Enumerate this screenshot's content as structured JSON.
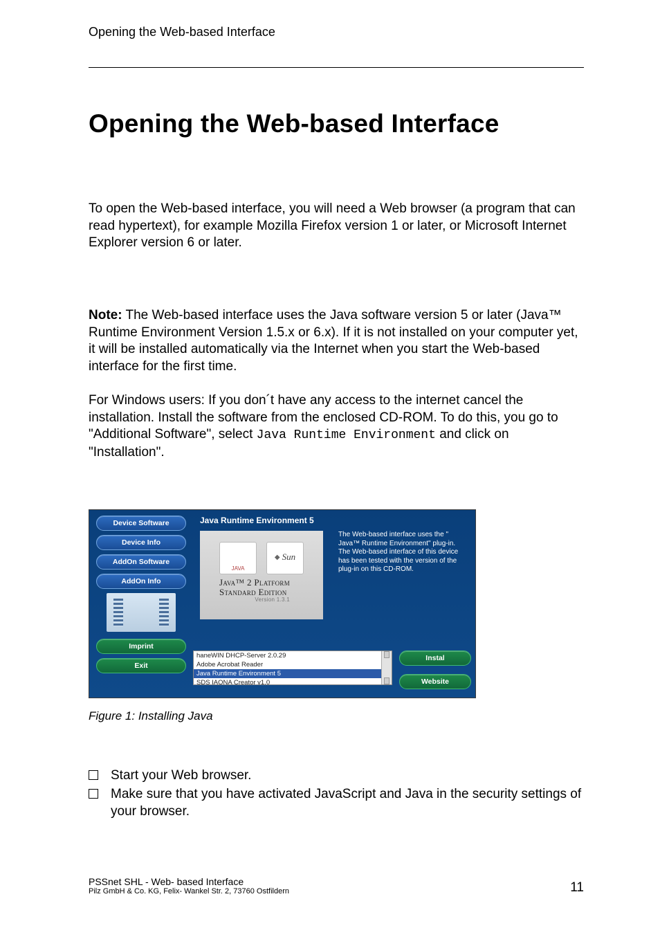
{
  "header": {
    "running": "Opening the Web-based Interface"
  },
  "chapter": {
    "title": "Opening the Web-based Interface"
  },
  "paragraphs": {
    "intro": "To open the Web-based interface, you will need a Web browser (a program that can read hypertext), for example Mozilla Firefox version 1 or later, or Microsoft Internet Explorer version 6 or later.",
    "note_label": "Note:",
    "note_body": " The Web-based interface uses the Java software version 5 or later (Java™ Runtime Environment Version 1.5.x or 6.x). If it is not installed on your computer yet, it will be installed automatically via the Internet when you start the Web-based interface for the first time.",
    "windows_pre": "For Windows users: If you don´t have any access to the internet cancel the installation. Install the software from the enclosed CD-ROM. To do this, you go to \"Additional Software\", select ",
    "windows_code": "Java Runtime Environment",
    "windows_post": " and click on \"Installation\"."
  },
  "figure": {
    "nav": {
      "device_software": "Device Software",
      "device_info": "Device Info",
      "addon_software": "AddOn Software",
      "addon_info": "AddOn Info",
      "imprint": "Imprint",
      "exit": "Exit"
    },
    "panel_title": "Java Runtime Environment 5",
    "badges": {
      "java": "JAVA",
      "sun": "Sun"
    },
    "platform": {
      "line1": "Java™ 2 Platform",
      "line2": "Standard Edition",
      "version": "Version 1.3.1"
    },
    "description": "The Web-based interface uses the \" Java™ Runtime Environment\" plug-in. The Web-based interface of this device has been tested with the version of the plug-in on this CD-ROM.",
    "list": {
      "opt1": "haneWIN DHCP-Server 2.0.29",
      "opt2": "Adobe Acrobat Reader",
      "opt3": "Java Runtime Environment 5",
      "opt4": "SDS IAONA Creator v1.0"
    },
    "actions": {
      "install": "Instal",
      "website": "Website"
    },
    "caption_label": "Figure 1:",
    "caption_text": "   Installing Java"
  },
  "steps": {
    "s1": "Start your Web browser.",
    "s2": "Make sure that you have activated JavaScript and Java in the security settings of your browser."
  },
  "footer": {
    "line1": "PSSnet SHL - Web- based Interface",
    "line2": "Pilz GmbH & Co. KG, Felix- Wankel Str. 2, 73760 Ostfildern",
    "page": "11"
  }
}
